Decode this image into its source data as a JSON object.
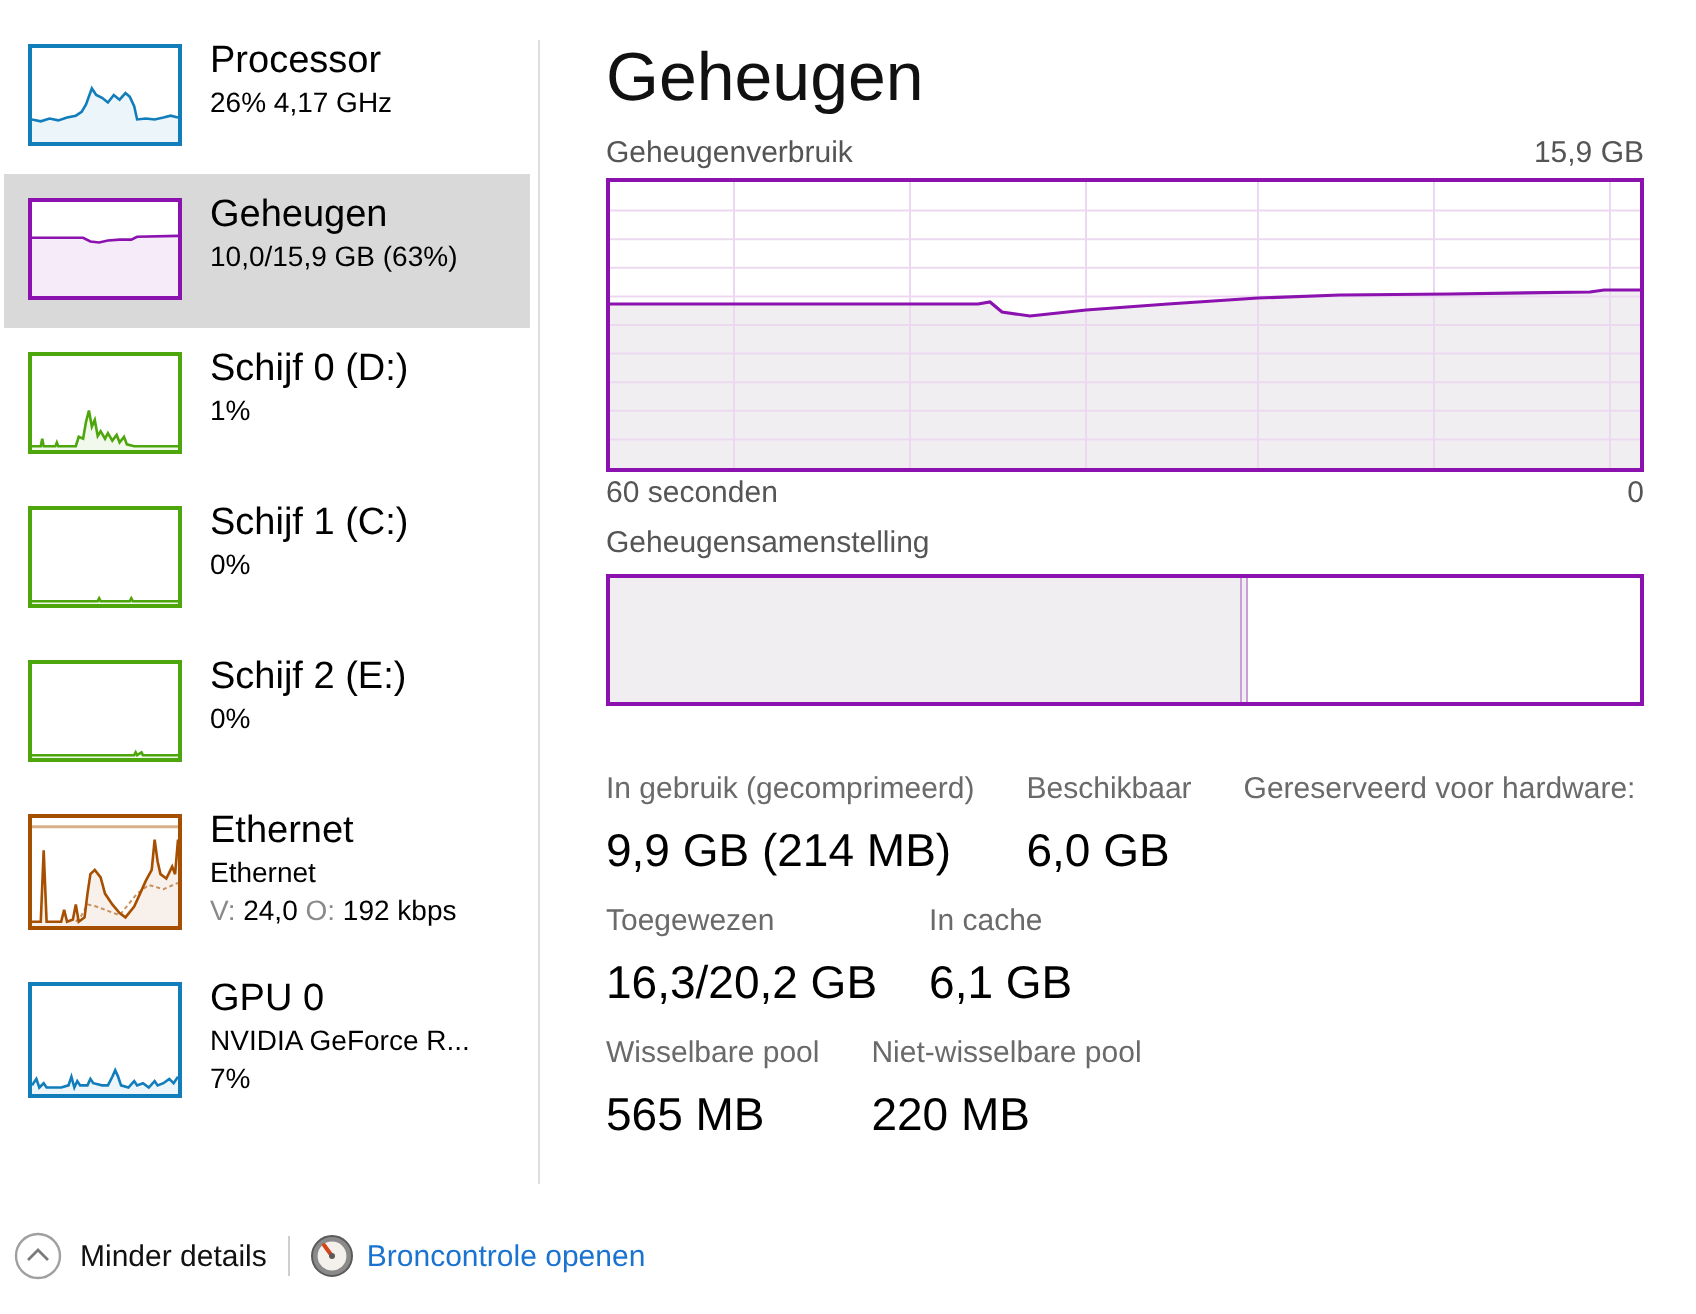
{
  "sidebar": {
    "items": [
      {
        "title": "Processor",
        "lines": [
          "26% 4,17 GHz"
        ],
        "color": "#117dbb",
        "selected": false
      },
      {
        "title": "Geheugen",
        "lines": [
          "10,0/15,9 GB (63%)"
        ],
        "color": "#8b12ae",
        "selected": true
      },
      {
        "title": "Schijf 0 (D:)",
        "lines": [
          "1%"
        ],
        "color": "#4da60c",
        "selected": false
      },
      {
        "title": "Schijf 1 (C:)",
        "lines": [
          "0%"
        ],
        "color": "#4da60c",
        "selected": false
      },
      {
        "title": "Schijf 2 (E:)",
        "lines": [
          "0%"
        ],
        "color": "#4da60c",
        "selected": false
      },
      {
        "title": "Ethernet",
        "lines": [
          "Ethernet"
        ],
        "throughput": [
          {
            "label": "V:",
            "value": "24,0"
          },
          {
            "label": "O:",
            "value": "192 kbps"
          }
        ],
        "color": "#a74f01",
        "selected": false
      },
      {
        "title": "GPU 0",
        "lines": [
          "NVIDIA GeForce R...",
          "7%"
        ],
        "color": "#117dbb",
        "selected": false
      }
    ]
  },
  "panel": {
    "title": "Geheugen",
    "usage_chart": {
      "label": "Geheugenverbruik",
      "max_label": "15,9 GB",
      "start_label": "60 seconden",
      "end_label": "0"
    },
    "composition": {
      "label": "Geheugensamenstelling",
      "level": 0.62
    },
    "stat_rows": [
      {
        "items": [
          {
            "label": "In gebruik (gecomprimeerd)",
            "value": "9,9 GB (214 MB)"
          },
          {
            "label": "Beschikbaar",
            "value": "6,0 GB"
          },
          {
            "label": "Gereserveerd voor hardware:"
          }
        ]
      },
      {
        "items": [
          {
            "label": "Toegewezen",
            "value": "16,3/20,2 GB"
          },
          {
            "label": "In cache",
            "value": "6,1 GB"
          }
        ]
      },
      {
        "items": [
          {
            "label": "Wisselbare pool",
            "value": "565 MB"
          },
          {
            "label": "Niet-wisselbare pool",
            "value": "220 MB"
          }
        ]
      }
    ]
  },
  "footer": {
    "fewer_details": "Minder details",
    "monitor_link": "Broncontrole openen"
  }
}
